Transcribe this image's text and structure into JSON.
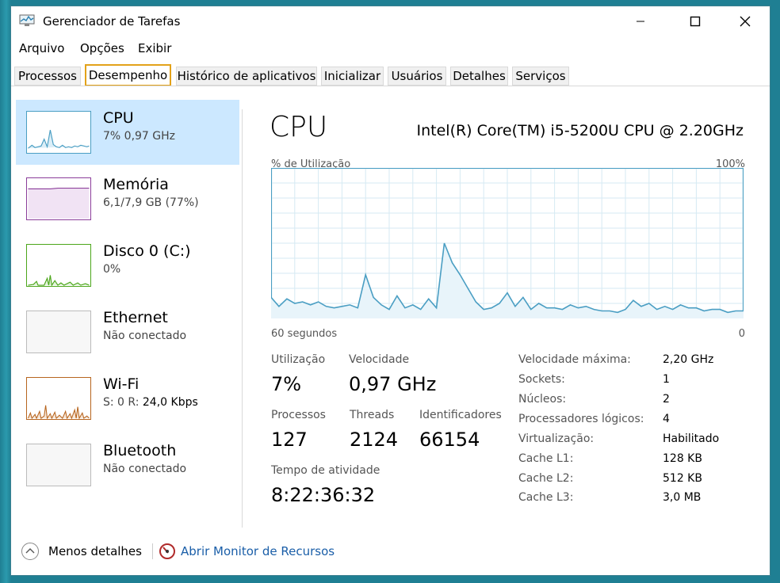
{
  "window": {
    "title": "Gerenciador de Tarefas"
  },
  "menu": [
    "Arquivo",
    "Opções",
    "Exibir"
  ],
  "tabs": [
    "Processos",
    "Desempenho",
    "Histórico de aplicativos",
    "Inicializar",
    "Usuários",
    "Detalhes",
    "Serviços"
  ],
  "active_tab": "Desempenho",
  "sidebar": {
    "items": [
      {
        "name": "CPU",
        "sub": "7%  0,97 GHz",
        "color": "#4a9ec3",
        "selected": true
      },
      {
        "name": "Memória",
        "sub": "6,1/7,9 GB (77%)",
        "color": "#8b3d9a"
      },
      {
        "name": "Disco 0 (C:)",
        "sub": "0%",
        "color": "#4ca61b"
      },
      {
        "name": "Ethernet",
        "sub": "Não conectado",
        "color": "#bbbbbb"
      },
      {
        "name": "Wi-Fi",
        "sub": "S: 0  R: 24,0 Kbps",
        "sub_parts": {
          "send": "S: 0",
          "recv_label": "R:",
          "recv_value": "24,0 Kbps"
        },
        "color": "#b7651e"
      },
      {
        "name": "Bluetooth",
        "sub": "Não conectado",
        "color": "#bbbbbb"
      }
    ]
  },
  "main": {
    "title": "CPU",
    "model": "Intel(R) Core(TM) i5-5200U CPU @ 2.20GHz",
    "graph": {
      "ylabel": "% de Utilização",
      "ymax_label": "100%",
      "xlabel_left": "60 segundos",
      "xlabel_right": "0"
    },
    "stats": {
      "utilizacao_label": "Utilização",
      "utilizacao": "7%",
      "velocidade_label": "Velocidade",
      "velocidade": "0,97 GHz",
      "processos_label": "Processos",
      "processos": "127",
      "threads_label": "Threads",
      "threads": "2124",
      "identificadores_label": "Identificadores",
      "identificadores": "66154",
      "tempo_label": "Tempo de atividade",
      "tempo": "8:22:36:32"
    },
    "specs": [
      {
        "key": "Velocidade máxima:",
        "value": "2,20 GHz"
      },
      {
        "key": "Sockets:",
        "value": "1"
      },
      {
        "key": "Núcleos:",
        "value": "2"
      },
      {
        "key": "Processadores lógicos:",
        "value": "4"
      },
      {
        "key": "Virtualização:",
        "value": "Habilitado"
      },
      {
        "key": "Cache L1:",
        "value": "128 KB"
      },
      {
        "key": "Cache L2:",
        "value": "512 KB"
      },
      {
        "key": "Cache L3:",
        "value": "3,0 MB"
      }
    ]
  },
  "bottom": {
    "less_details": "Menos detalhes",
    "resource_monitor": "Abrir Monitor de Recursos"
  },
  "chart_data": {
    "type": "area",
    "ylabel": "% de Utilização",
    "ylim": [
      0,
      100
    ],
    "xlabel": "60 segundos",
    "x": [
      60,
      59,
      58,
      57,
      56,
      55,
      54,
      53,
      52,
      51,
      50,
      49,
      48,
      47,
      46,
      45,
      44,
      43,
      42,
      41,
      40,
      39,
      38,
      37,
      36,
      35,
      34,
      33,
      32,
      31,
      30,
      29,
      28,
      27,
      26,
      25,
      24,
      23,
      22,
      21,
      20,
      19,
      18,
      17,
      16,
      15,
      14,
      13,
      12,
      11,
      10,
      9,
      8,
      7,
      6,
      5,
      4,
      3,
      2,
      1,
      0
    ],
    "series": [
      {
        "values": [
          14,
          8,
          13,
          10,
          11,
          9,
          11,
          8,
          7,
          8,
          9,
          7,
          29,
          14,
          9,
          6,
          15,
          7,
          9,
          6,
          13,
          7,
          50,
          37,
          29,
          20,
          11,
          6,
          7,
          10,
          17,
          8,
          14,
          6,
          10,
          7,
          7,
          6,
          9,
          7,
          8,
          6,
          5,
          5,
          4,
          6,
          12,
          8,
          10,
          6,
          8,
          6,
          9,
          7,
          7,
          5,
          6,
          6,
          4,
          5,
          5
        ]
      }
    ],
    "grid": true,
    "line_color": "#4a9ec3"
  }
}
